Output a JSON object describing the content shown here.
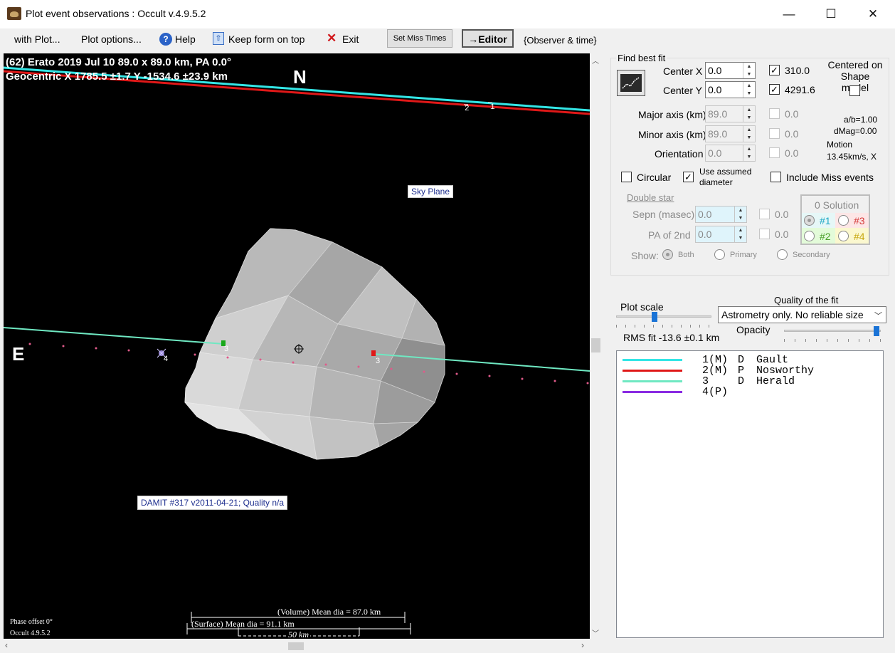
{
  "window": {
    "title": "Plot event observations : Occult v.4.9.5.2",
    "minimize": "—",
    "maximize": "☐",
    "close": "✕"
  },
  "menu": {
    "with_plot": "with Plot...",
    "plot_options": "Plot options...",
    "help": "Help",
    "keep_form": "Keep form on top",
    "exit": "Exit",
    "set_miss_times": "Set Miss Times",
    "editor": "→Editor",
    "observer_time": "{Observer & time}"
  },
  "plot": {
    "header_line1": "(62) Erato  2019 Jul 10  89.0 x 89.0 km, PA 0.0°",
    "header_line2": "Geocentric  X  1785.5 ±1.7  Y -1534.6 ±23.9 km",
    "north": "N",
    "east": "E",
    "sky_plane": "Sky Plane",
    "damit": "DAMIT #317 v2011-04-21; Quality n/a",
    "volume_dia": "(Volume) Mean dia = 87.0 km",
    "surface_dia": "(Surface) Mean dia = 91.1 km",
    "scale_bar": "50 km",
    "phase_offset": "Phase offset 0°",
    "version": "Occult 4.9.5.2",
    "chord_labels": [
      "1",
      "2",
      "3",
      "3",
      "4"
    ]
  },
  "fit": {
    "find_best_fit": "Find best fit",
    "center_x_label": "Center X",
    "center_x": "0.0",
    "center_x_fixed": "310.0",
    "center_x_checked": true,
    "center_y_label": "Center Y",
    "center_y": "0.0",
    "center_y_fixed": "4291.6",
    "center_y_checked": true,
    "centered_on": "Centered on Shape model",
    "major_label": "Major axis (km)",
    "major": "89.0",
    "major_fixed": "0.0",
    "minor_label": "Minor axis (km)",
    "minor": "89.0",
    "minor_fixed": "0.0",
    "orient_label": "Orientation",
    "orient": "0.0",
    "orient_fixed": "0.0",
    "ab_ratio": "a/b=1.00",
    "dmag": "dMag=0.00",
    "motion_label": "Motion",
    "motion": "13.45km/s, X",
    "circular": "Circular",
    "use_assumed": "Use assumed diameter",
    "include_miss": "Include Miss events",
    "double_star": "Double star",
    "sepn_label": "Sepn (masec)",
    "sepn": "0.0",
    "sepn_fixed": "0.0",
    "pa2_label": "PA of 2nd",
    "pa2": "0.0",
    "pa2_fixed": "0.0",
    "solution_title": "0 Solution",
    "sol1": "#1",
    "sol2": "#2",
    "sol3": "#3",
    "sol4": "#4",
    "show_label": "Show:",
    "show_both": "Both",
    "show_primary": "Primary",
    "show_secondary": "Secondary",
    "plot_scale": "Plot scale",
    "quality_label": "Quality of the fit",
    "quality_value": "Astrometry only. No reliable size",
    "rms": "RMS fit -13.6 ±0.1 km",
    "opacity": "Opacity"
  },
  "legend": [
    {
      "id": "1(M)",
      "type": "D",
      "name": "Gault",
      "color": "#33e6e6"
    },
    {
      "id": "2(M)",
      "type": "P",
      "name": "Nosworthy",
      "color": "#e01818"
    },
    {
      "id": "3",
      "type": "D",
      "name": "Herald",
      "color": "#6fe8c2"
    },
    {
      "id": "4(P)",
      "type": "",
      "name": "",
      "color": "#8a2be2"
    }
  ]
}
